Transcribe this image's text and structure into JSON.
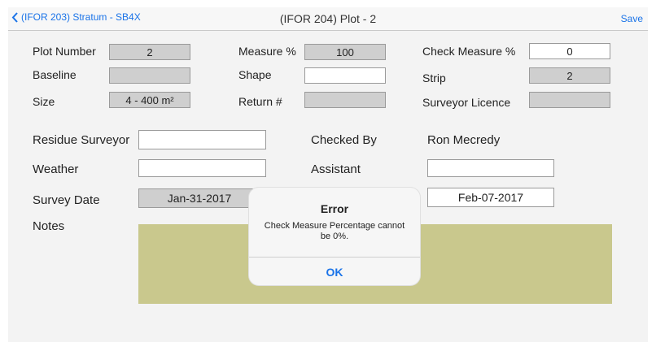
{
  "nav": {
    "back_label": "(IFOR 203) Stratum - SB4X",
    "title": "(IFOR 204) Plot - 2",
    "save_label": "Save"
  },
  "form": {
    "plot_number": {
      "label": "Plot Number",
      "value": "2"
    },
    "measure_pct": {
      "label": "Measure %",
      "value": "100"
    },
    "check_measure_pct": {
      "label": "Check Measure %",
      "value": "0"
    },
    "baseline": {
      "label": "Baseline",
      "value": ""
    },
    "shape": {
      "label": "Shape",
      "value": ""
    },
    "strip": {
      "label": "Strip",
      "value": "2"
    },
    "size": {
      "label": "Size",
      "value": "4 - 400 m²"
    },
    "return_no": {
      "label": "Return #",
      "value": ""
    },
    "surveyor_licence": {
      "label": "Surveyor Licence",
      "value": ""
    },
    "residue_surveyor": {
      "label": "Residue Surveyor",
      "value": ""
    },
    "checked_by": {
      "label": "Checked By",
      "value": "Ron Mecredy"
    },
    "weather": {
      "label": "Weather",
      "value": ""
    },
    "assistant": {
      "label": "Assistant",
      "value": ""
    },
    "survey_date": {
      "label": "Survey Date",
      "value": "Jan-31-2017"
    },
    "check_date": {
      "value": "Feb-07-2017"
    },
    "notes": {
      "label": "Notes",
      "value": ""
    }
  },
  "dialog": {
    "title": "Error",
    "message": "Check Measure Percentage cannot be 0%.",
    "ok_label": "OK"
  },
  "colors": {
    "accent": "#1a73e8",
    "notes_bg": "#c9c88d",
    "readonly_field": "#cfcfcf"
  }
}
